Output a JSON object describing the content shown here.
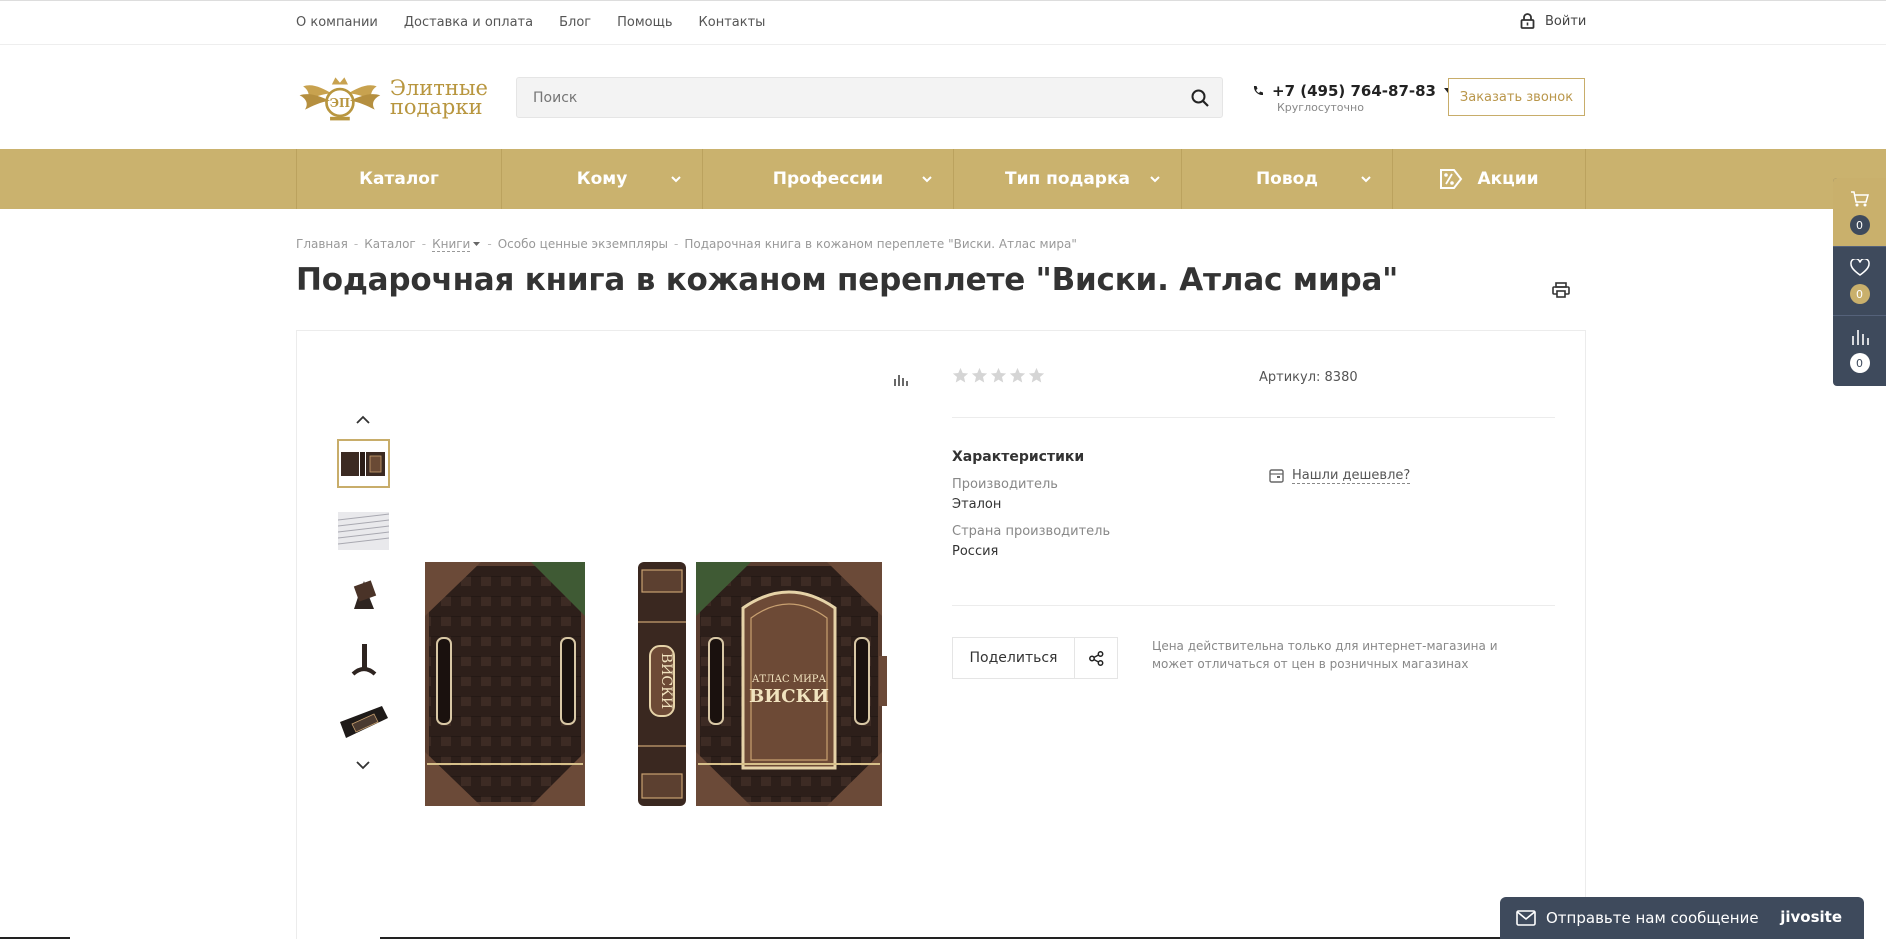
{
  "topnav": {
    "items": [
      "О компании",
      "Доставка и оплата",
      "Блог",
      "Помощь",
      "Контакты"
    ],
    "login_label": "Войти"
  },
  "header": {
    "logo_line1": "Элитные",
    "logo_line2": "подарки",
    "search_placeholder": "Поиск",
    "phone": "+7 (495) 764-87-83",
    "phone_sub": "Круглосуточно",
    "callback_label": "Заказать звонок"
  },
  "menu": {
    "items": [
      "Каталог",
      "Кому",
      "Профессии",
      "Тип подарка",
      "Повод",
      "Акции"
    ]
  },
  "sidepanel": {
    "cart_count": "0",
    "favorites_count": "0",
    "compare_count": "0"
  },
  "breadcrumb": [
    "Главная",
    "Каталог",
    "Книги",
    "Особо ценные экземпляры",
    "Подарочная книга в кожаном переплете \"Виски. Атлас мира\""
  ],
  "product": {
    "title": "Подарочная книга в кожаном переплете \"Виски. Атлас мира\"",
    "rating": 0,
    "rating_max": 5,
    "sku_label": "Артикул: 8380",
    "characteristics_title": "Характеристики",
    "props": [
      {
        "label": "Производитель",
        "value": "Эталон"
      },
      {
        "label": "Страна производитель",
        "value": "Россия"
      }
    ],
    "cheaper_label": "Нашли дешевле?",
    "share_label": "Поделиться",
    "price_note": "Цена действительна только для интернет-магазина и может отличаться от цен в розничных магазинах",
    "cover_text_1": "АТЛАС МИРА",
    "cover_text_2": "ВИСКИ",
    "spine_text": "ВИСКИ"
  },
  "chat": {
    "label": "Отправьте нам сообщение",
    "brand": "jivosite"
  },
  "colors": {
    "gold": "#cab26e",
    "gold_text": "#b9964a",
    "panel_dark": "#3e4a5c"
  }
}
